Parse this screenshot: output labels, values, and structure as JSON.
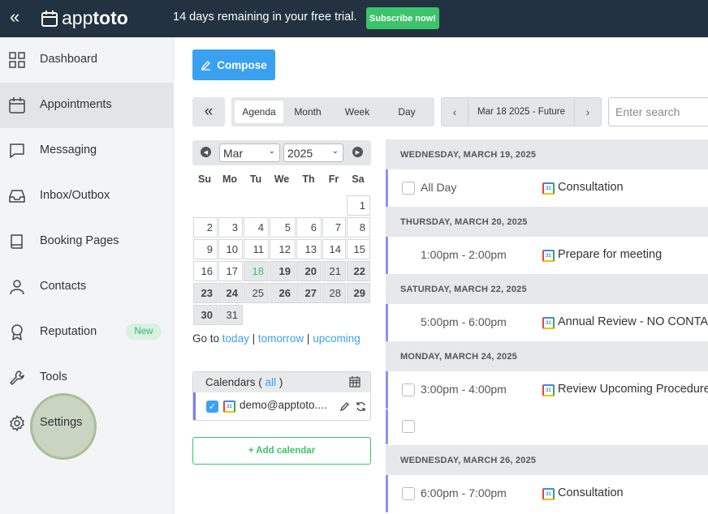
{
  "topbar": {
    "logo_prefix": "app",
    "logo_suffix": "toto",
    "trial_text": "14 days remaining in your free trial.",
    "subscribe_label": "Subscribe now!"
  },
  "sidebar": {
    "items": [
      {
        "label": "Dashboard",
        "icon": "grid-icon"
      },
      {
        "label": "Appointments",
        "icon": "calendar-icon"
      },
      {
        "label": "Messaging",
        "icon": "chat-icon"
      },
      {
        "label": "Inbox/Outbox",
        "icon": "inbox-icon"
      },
      {
        "label": "Booking Pages",
        "icon": "book-icon"
      },
      {
        "label": "Contacts",
        "icon": "person-icon"
      },
      {
        "label": "Reputation",
        "icon": "award-icon",
        "badge": "New"
      },
      {
        "label": "Tools",
        "icon": "wrench-icon"
      },
      {
        "label": "Settings",
        "icon": "gear-icon"
      }
    ]
  },
  "toolbar": {
    "compose_label": "Compose",
    "views": [
      "Agenda",
      "Month",
      "Week",
      "Day"
    ],
    "active_view": "Agenda",
    "date_range": "Mar 18 2025 - Future",
    "search_placeholder": "Enter search"
  },
  "mini_calendar": {
    "month": "Mar",
    "year": "2025",
    "weekdays": [
      "Su",
      "Mo",
      "Tu",
      "We",
      "Th",
      "Fr",
      "Sa"
    ],
    "today": 18
  },
  "goto": {
    "prefix": "Go to",
    "today": "today",
    "sep": "|",
    "tomorrow": "tomorrow",
    "upcoming": "upcoming"
  },
  "calendars": {
    "title_prefix": "Calendars (",
    "all_label": "all",
    "title_suffix": ")",
    "account": "demo@apptoto....",
    "add_label": "+ Add calendar"
  },
  "agenda": [
    {
      "date": "WEDNESDAY, MARCH 19, 2025",
      "events": [
        {
          "time": "All Day",
          "title": "Consultation",
          "checkbox": true,
          "calendar": true
        }
      ]
    },
    {
      "date": "THURSDAY, MARCH 20, 2025",
      "events": [
        {
          "time": "1:00pm - 2:00pm",
          "title": "Prepare for meeting",
          "checkbox": false,
          "calendar": true
        }
      ]
    },
    {
      "date": "SATURDAY, MARCH 22, 2025",
      "events": [
        {
          "time": "5:00pm - 6:00pm",
          "title": "Annual Review - NO CONTACT",
          "checkbox": false,
          "calendar": true
        }
      ]
    },
    {
      "date": "MONDAY, MARCH 24, 2025",
      "events": [
        {
          "time": "3:00pm - 4:00pm",
          "title": "Review Upcoming Procedures",
          "checkbox": true,
          "calendar": true
        },
        {
          "time": "",
          "title": "",
          "checkbox": true,
          "calendar": false
        }
      ]
    },
    {
      "date": "WEDNESDAY, MARCH 26, 2025",
      "events": [
        {
          "time": "6:00pm - 7:00pm",
          "title": "Consultation",
          "checkbox": true,
          "calendar": true
        }
      ]
    }
  ],
  "colors": {
    "topbar": "#233240",
    "accent": "#3aa1f0",
    "green": "#3cc46a",
    "event_bar": "#8d92f2"
  }
}
